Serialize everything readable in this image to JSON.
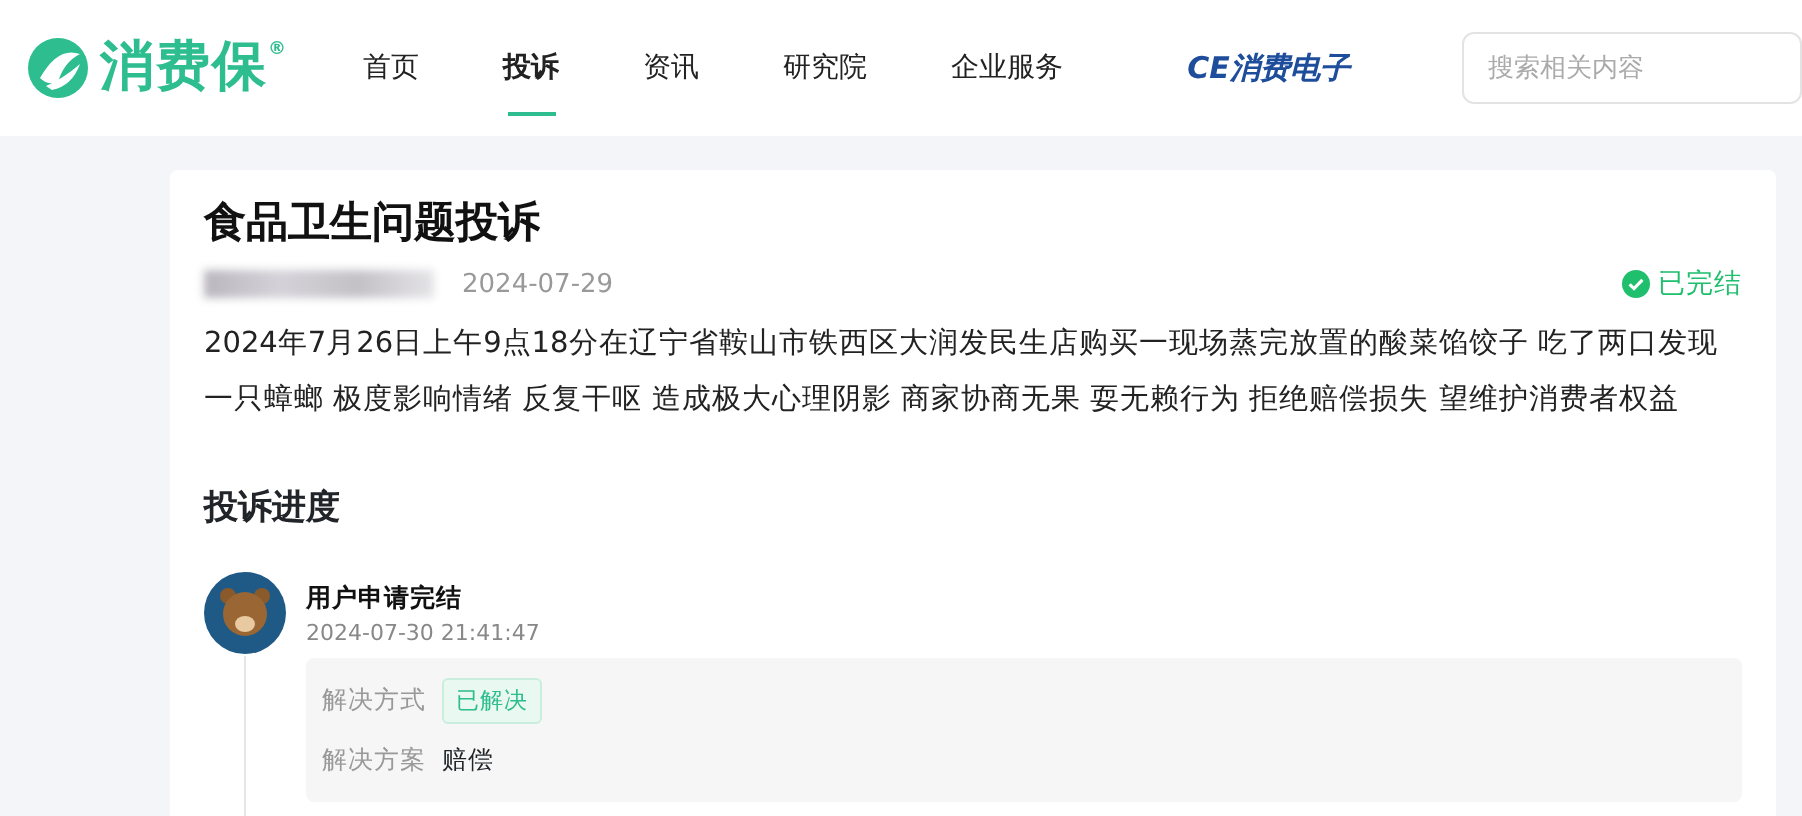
{
  "header": {
    "logo": "消费保$^{®}$",
    "nav": [
      {
        "label": "首页",
        "selected": false
      },
      {
        "label": "投诉",
        "selected": true
      },
      {
        "label": "资讯",
        "selected": false
      },
      {
        "label": "研究院",
        "selected": false
      },
      {
        "label": "企业服务",
        "selected": false
      }
    ],
    "partner_logo": "CE消费电子",
    "search": {
      "placeholder": "搜索相关内容"
    }
  },
  "complaint": {
    "title": "食品卫生问题投诉",
    "date": "2024-07-29",
    "status": "已完结",
    "description": "2024年7月26日上午9点18分在辽宁省鞍山市铁西区大润发民生店购买一现场蒸完放置的酸菜馅饺子 吃了两口发现一只蟑螂 极度影响情绪 反复干呕 造成极大心理阴影 商家协商无果 耍无赖行为 拒绝赔偿损失 望维护消费者权益"
  },
  "progress": {
    "heading": "投诉进度",
    "events": [
      {
        "title": "用户申请完结",
        "time": "2024-07-30 21:41:47",
        "fields": [
          {
            "label": "解决方式",
            "value": "已解决",
            "kind": "tag"
          },
          {
            "label": "解决方案",
            "value": "赔偿",
            "kind": "text"
          }
        ]
      }
    ]
  }
}
